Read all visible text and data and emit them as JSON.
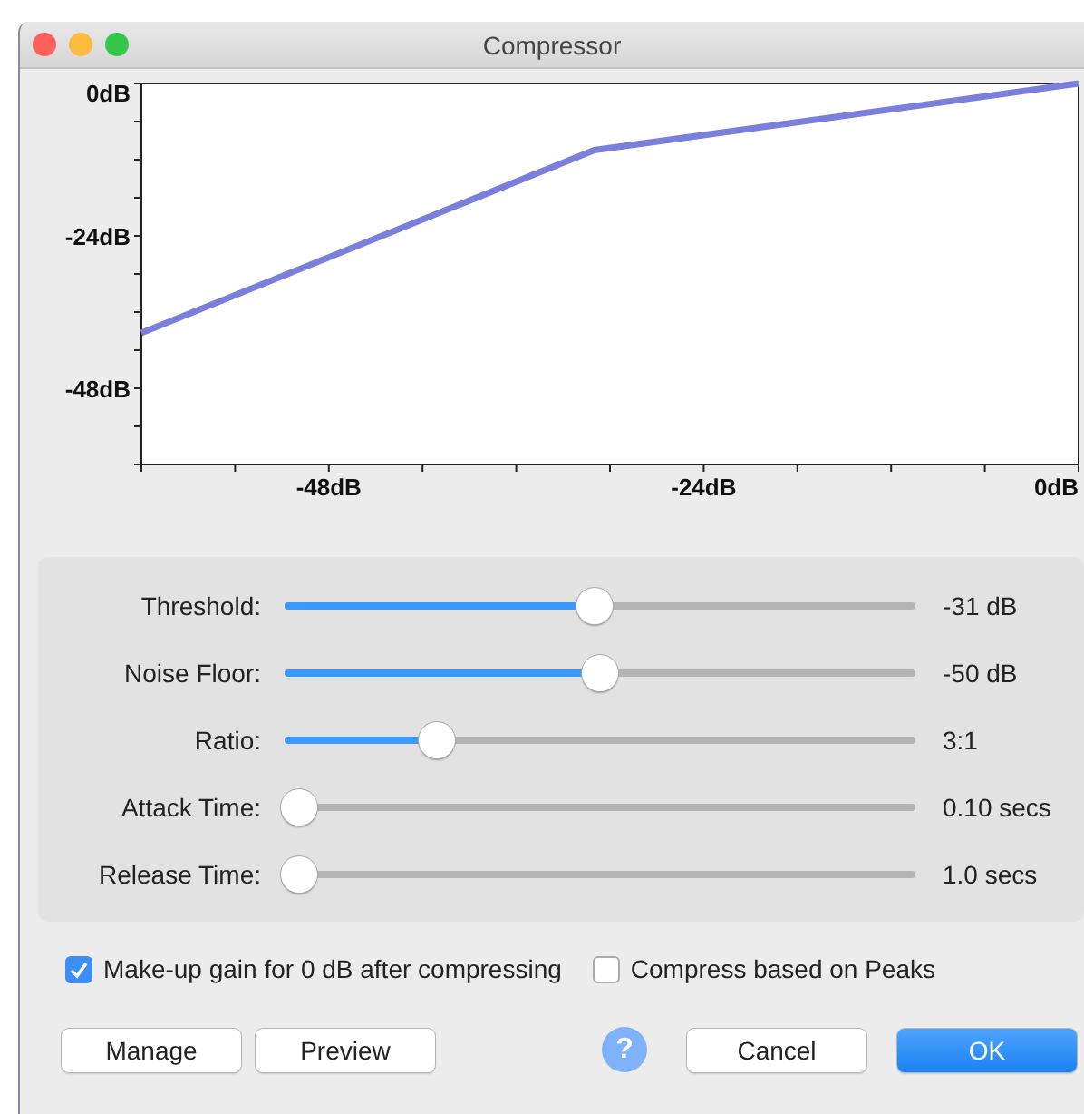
{
  "window": {
    "title": "Compressor"
  },
  "graph": {
    "chart_data": {
      "type": "line",
      "xlim": [
        -60,
        0
      ],
      "ylim": [
        -60,
        0
      ],
      "xticks": [
        {
          "value": -48,
          "label": "-48dB"
        },
        {
          "value": -24,
          "label": "-24dB"
        },
        {
          "value": 0,
          "label": "0dB"
        }
      ],
      "yticks": [
        {
          "value": 0,
          "label": "0dB"
        },
        {
          "value": -24,
          "label": "-24dB"
        },
        {
          "value": -48,
          "label": "-48dB"
        }
      ],
      "x": [
        -60,
        -31,
        0
      ],
      "series": [
        {
          "color": "#7b7fdc",
          "values": [
            -39.3,
            -10.5,
            0
          ]
        }
      ]
    }
  },
  "sliders": [
    {
      "label": "Threshold:",
      "level": 0.49,
      "reading": "-31 dB"
    },
    {
      "label": "Noise Floor:",
      "level": 0.5,
      "reading": "-50 dB"
    },
    {
      "label": "Ratio:",
      "level": 0.23,
      "reading": "3:1"
    },
    {
      "label": "Attack Time:",
      "level": 0,
      "reading": "0.10 secs"
    },
    {
      "label": "Release Time:",
      "level": 0,
      "reading": "1.0 secs"
    }
  ],
  "options": [
    {
      "label": "Make-up gain for 0 dB after compressing",
      "checked": true
    },
    {
      "label": "Compress based on Peaks",
      "checked": false
    }
  ],
  "buttons": [
    {
      "label": "Manage",
      "kind": "plain"
    },
    {
      "label": "Preview",
      "kind": "plain"
    },
    {
      "label": "?",
      "kind": "help"
    },
    {
      "label": "Cancel",
      "kind": "plain"
    },
    {
      "label": "OK",
      "kind": "default"
    }
  ]
}
